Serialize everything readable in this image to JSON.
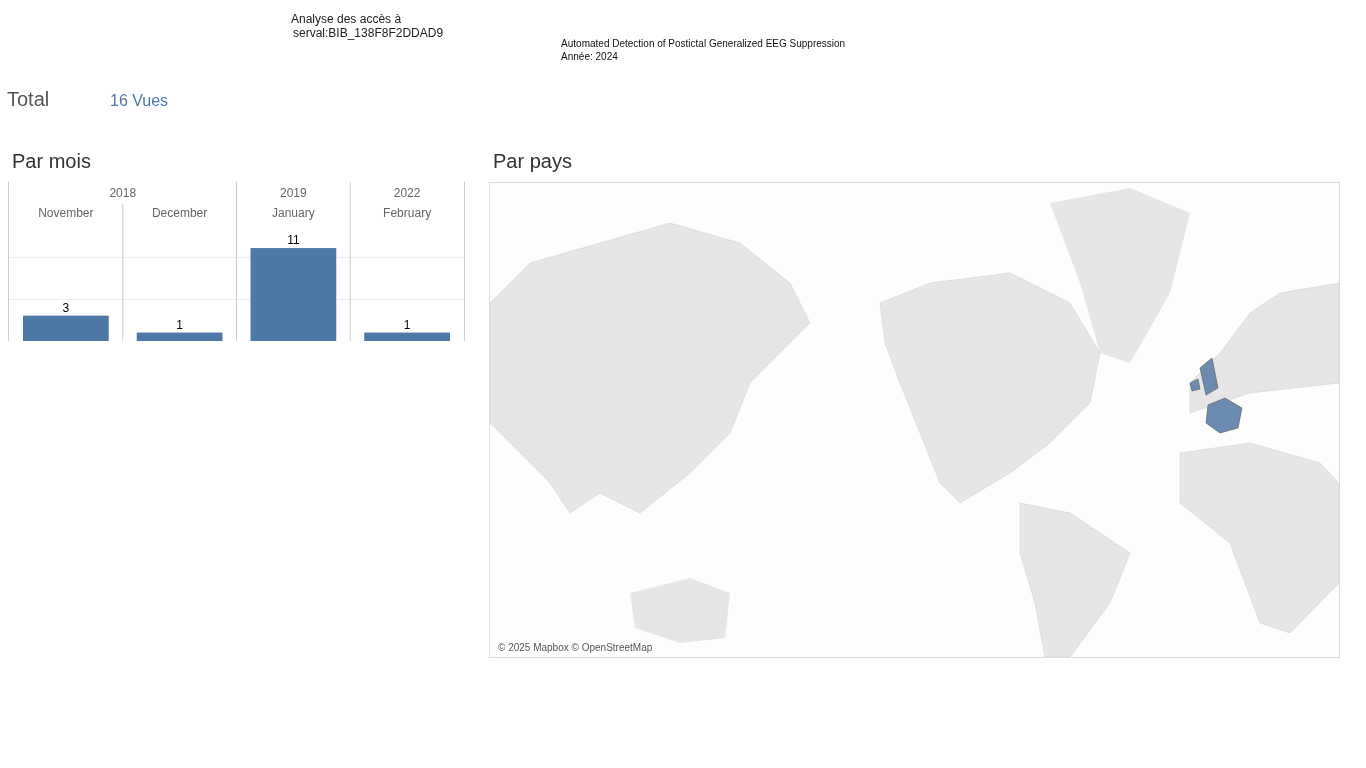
{
  "header": {
    "title_line_1": "Analyse des accès à",
    "title_line_2": "serval:BIB_138F8F2DDAD9",
    "document_title": "Automated Detection of Postictal Generalized EEG Suppression",
    "year": "Année: 2024"
  },
  "total": {
    "label": "Total",
    "value": "16 Vues"
  },
  "by_month": {
    "title": "Par mois",
    "years": [
      {
        "label": "2018",
        "spans_two_months": true
      },
      {
        "label": "2019",
        "spans_two_months": false
      },
      {
        "label": "2022",
        "spans_two_months": false
      }
    ],
    "chart_data": {
      "type": "bar",
      "categories": [
        "November",
        "December",
        "January",
        "February"
      ],
      "values": [
        3,
        1,
        11,
        1
      ],
      "data_labels": true
    }
  },
  "by_country": {
    "title": "Par pays",
    "attribution": "© 2025 Mapbox © OpenStreetMap"
  }
}
